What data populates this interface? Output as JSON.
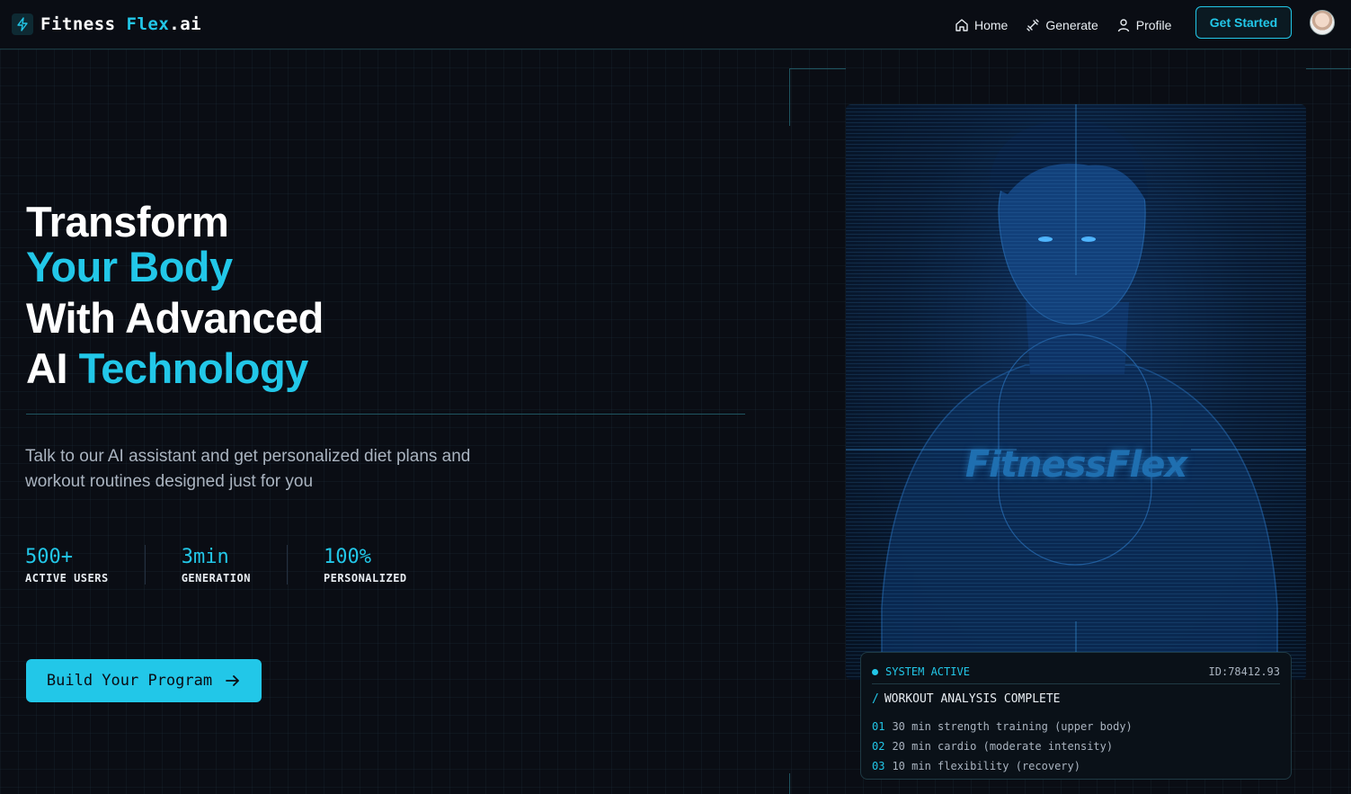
{
  "brand": {
    "name_part1": "Fitness ",
    "name_part2": "Flex",
    "name_part3": ".ai"
  },
  "nav": {
    "links": [
      {
        "label": "Home",
        "icon": "home-icon"
      },
      {
        "label": "Generate",
        "icon": "dumbbell-icon"
      },
      {
        "label": "Profile",
        "icon": "user-icon"
      }
    ],
    "cta": "Get Started"
  },
  "hero": {
    "line1": "Transform",
    "line2": "Your Body",
    "line3": "With Advanced",
    "line4_a": "AI ",
    "line4_b": "Technology",
    "subtitle": "Talk to our AI assistant and get personalized diet plans and workout routines designed just for you",
    "stats": [
      {
        "value": "500+",
        "label": "ACTIVE USERS"
      },
      {
        "value": "3min",
        "label": "GENERATION"
      },
      {
        "value": "100%",
        "label": "PERSONALIZED"
      }
    ],
    "cta": "Build Your Program"
  },
  "image": {
    "watermark": "FitnessFlex"
  },
  "status_card": {
    "status": "SYSTEM ACTIVE",
    "id": "ID:78412.93",
    "heading_slash": "/",
    "heading": "WORKOUT ANALYSIS COMPLETE",
    "items": [
      {
        "num": "01",
        "text": "30 min strength training (upper body)"
      },
      {
        "num": "02",
        "text": "20 min cardio (moderate intensity)"
      },
      {
        "num": "03",
        "text": "10 min flexibility (recovery)"
      }
    ]
  },
  "colors": {
    "accent": "#22c7e8",
    "background": "#0a0d14",
    "text": "#e8edf2",
    "muted": "#aab4c0"
  }
}
